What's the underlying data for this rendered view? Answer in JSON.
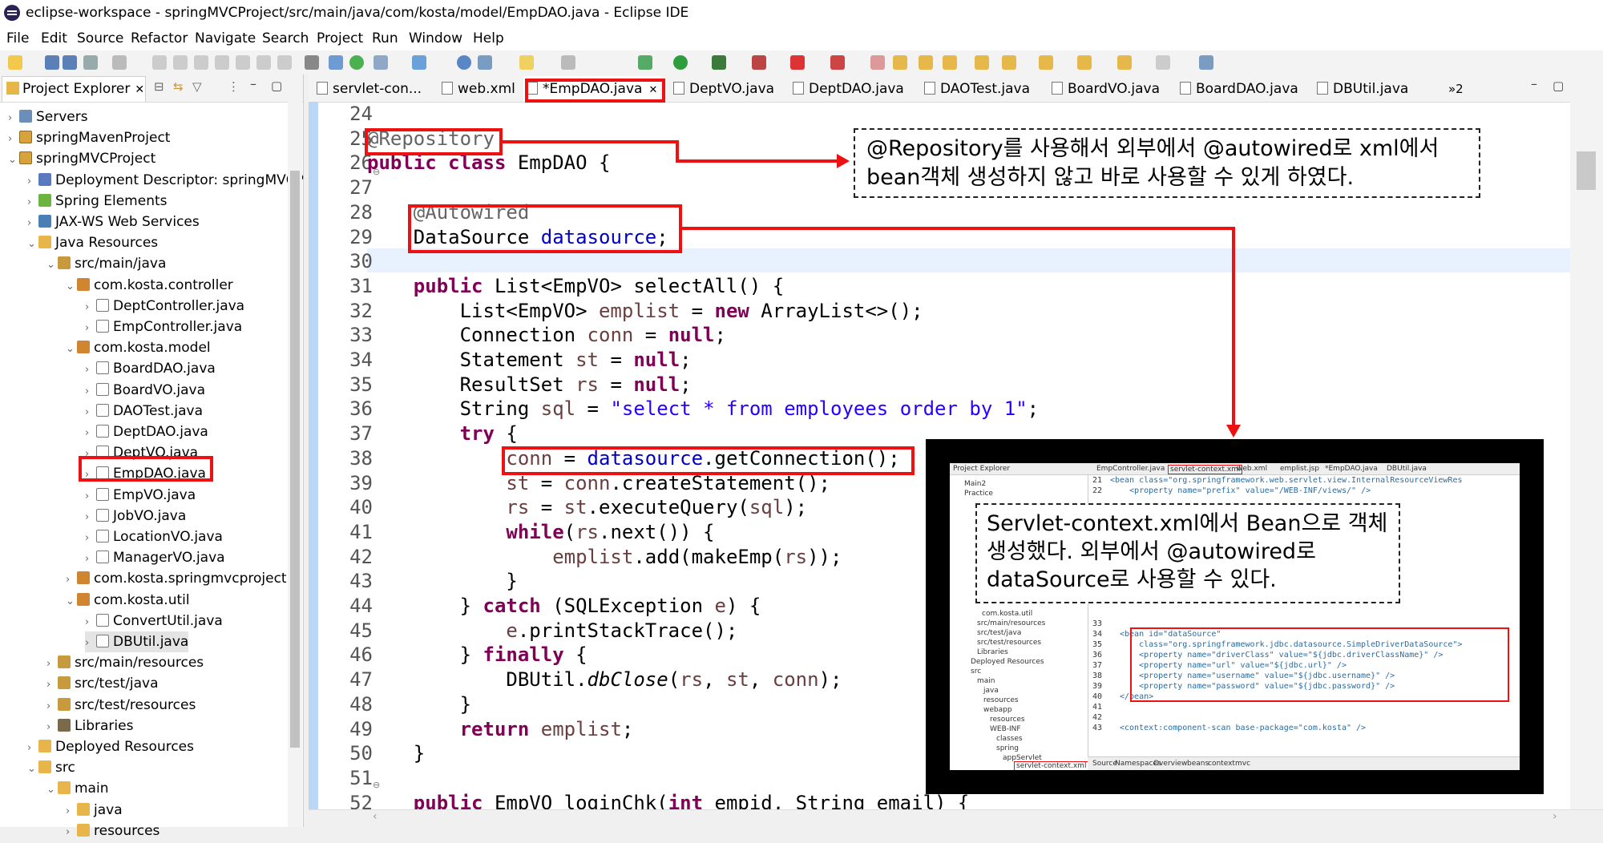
{
  "title": "eclipse-workspace - springMVCProject/src/main/java/com/kosta/model/EmpDAO.java - Eclipse IDE",
  "menu": [
    "File",
    "Edit",
    "Source",
    "Refactor",
    "Navigate",
    "Search",
    "Project",
    "Run",
    "Window",
    "Help"
  ],
  "sidebar": {
    "tab_label": "Project Explorer",
    "items": [
      {
        "label": "Servers",
        "arrow": "›",
        "icon": "servers"
      },
      {
        "label": "springMavenProject",
        "arrow": "›",
        "icon": "project"
      },
      {
        "label": "springMVCProject",
        "arrow": "⌄",
        "icon": "project"
      },
      {
        "label": "Deployment Descriptor: springMVCP",
        "arrow": "›",
        "icon": "dd"
      },
      {
        "label": "Spring Elements",
        "arrow": "›",
        "icon": "spring"
      },
      {
        "label": "JAX-WS Web Services",
        "arrow": "›",
        "icon": "jaxws"
      },
      {
        "label": "Java Resources",
        "arrow": "⌄",
        "icon": "folder"
      },
      {
        "label": "src/main/java",
        "arrow": "⌄",
        "icon": "src"
      },
      {
        "label": "com.kosta.controller",
        "arrow": "⌄",
        "icon": "pkg"
      },
      {
        "label": "DeptController.java",
        "arrow": "›",
        "icon": "java"
      },
      {
        "label": "EmpController.java",
        "arrow": "›",
        "icon": "java"
      },
      {
        "label": "com.kosta.model",
        "arrow": "⌄",
        "icon": "pkg"
      },
      {
        "label": "BoardDAO.java",
        "arrow": "›",
        "icon": "java"
      },
      {
        "label": "BoardVO.java",
        "arrow": "›",
        "icon": "java"
      },
      {
        "label": "DAOTest.java",
        "arrow": "›",
        "icon": "java"
      },
      {
        "label": "DeptDAO.java",
        "arrow": "›",
        "icon": "java"
      },
      {
        "label": "DeptVO.java",
        "arrow": "›",
        "icon": "java"
      },
      {
        "label": "EmpDAO.java",
        "arrow": "›",
        "icon": "java"
      },
      {
        "label": "EmpVO.java",
        "arrow": "›",
        "icon": "java"
      },
      {
        "label": "JobVO.java",
        "arrow": "›",
        "icon": "java"
      },
      {
        "label": "LocationVO.java",
        "arrow": "›",
        "icon": "java"
      },
      {
        "label": "ManagerVO.java",
        "arrow": "›",
        "icon": "java"
      },
      {
        "label": "com.kosta.springmvcproject",
        "arrow": "›",
        "icon": "pkg"
      },
      {
        "label": "com.kosta.util",
        "arrow": "⌄",
        "icon": "pkg"
      },
      {
        "label": "ConvertUtil.java",
        "arrow": "›",
        "icon": "java"
      },
      {
        "label": "DBUtil.java",
        "arrow": "›",
        "icon": "java"
      },
      {
        "label": "src/main/resources",
        "arrow": "›",
        "icon": "src"
      },
      {
        "label": "src/test/java",
        "arrow": "›",
        "icon": "src"
      },
      {
        "label": "src/test/resources",
        "arrow": "›",
        "icon": "src"
      },
      {
        "label": "Libraries",
        "arrow": "›",
        "icon": "lib"
      },
      {
        "label": "Deployed Resources",
        "arrow": "›",
        "icon": "folder"
      },
      {
        "label": "src",
        "arrow": "⌄",
        "icon": "folder"
      },
      {
        "label": "main",
        "arrow": "⌄",
        "icon": "folder"
      },
      {
        "label": "java",
        "arrow": "›",
        "icon": "folder"
      },
      {
        "label": "resources",
        "arrow": "›",
        "icon": "folder"
      }
    ]
  },
  "editor": {
    "tabs": [
      {
        "label": "servlet-con...",
        "active": false
      },
      {
        "label": "web.xml",
        "active": false
      },
      {
        "label": "*EmpDAO.java",
        "active": true
      },
      {
        "label": "DeptVO.java",
        "active": false
      },
      {
        "label": "DeptDAO.java",
        "active": false
      },
      {
        "label": "DAOTest.java",
        "active": false
      },
      {
        "label": "BoardVO.java",
        "active": false
      },
      {
        "label": "BoardDAO.java",
        "active": false
      },
      {
        "label": "DBUtil.java",
        "active": false
      }
    ],
    "overflow_label": "»2",
    "line_numbers": [
      "24",
      "25",
      "26",
      "27",
      "28",
      "29",
      "30",
      "31",
      "32",
      "33",
      "34",
      "35",
      "36",
      "37",
      "38",
      "39",
      "40",
      "41",
      "42",
      "43",
      "44",
      "45",
      "46",
      "47",
      "48",
      "49",
      "50",
      "51",
      "52"
    ]
  },
  "code": {
    "l25": "@Repository",
    "l26a": "public class",
    "l26b": " EmpDAO {",
    "l28": "@Autowired",
    "l29a": "DataSource ",
    "l29b": "datasource",
    "l29c": ";",
    "l31a": "public",
    "l31b": " List<EmpVO> selectAll() {",
    "l32a": "List<EmpVO> ",
    "l32b": "emplist",
    "l32c": " = ",
    "l32d": "new",
    "l32e": " ArrayList<>();",
    "l33a": "Connection ",
    "l33b": "conn",
    "l33c": " = ",
    "l33d": "null",
    "l33e": ";",
    "l34a": "Statement ",
    "l34b": "st",
    "l34c": " = ",
    "l34d": "null",
    "l34e": ";",
    "l35a": "ResultSet ",
    "l35b": "rs",
    "l35c": " = ",
    "l35d": "null",
    "l35e": ";",
    "l36a": "String ",
    "l36b": "sql",
    "l36c": " = ",
    "l36d": "\"select * from employees order by 1\"",
    "l36e": ";",
    "l37a": "try",
    "l37b": " {",
    "l38a": "conn",
    "l38b": " = ",
    "l38c": "datasource",
    "l38d": ".getConnection();",
    "l39a": "st",
    "l39b": " = ",
    "l39c": "conn",
    "l39d": ".createStatement();",
    "l40a": "rs",
    "l40b": " = ",
    "l40c": "st",
    "l40d": ".executeQuery(",
    "l40e": "sql",
    "l40f": ");",
    "l41a": "while",
    "l41b": "(",
    "l41c": "rs",
    "l41d": ".next()) {",
    "l42a": "emplist",
    "l42b": ".add(makeEmp(",
    "l42c": "rs",
    "l42d": "));",
    "l43": "}",
    "l44a": "} ",
    "l44b": "catch",
    "l44c": " (SQLException ",
    "l44d": "e",
    "l44e": ") {",
    "l45a": "e",
    "l45b": ".printStackTrace();",
    "l46a": "} ",
    "l46b": "finally",
    "l46c": " {",
    "l47a": "DBUtil.",
    "l47b": "dbClose",
    "l47c": "(",
    "l47d": "rs",
    "l47e": ", ",
    "l47f": "st",
    "l47g": ", ",
    "l47h": "conn",
    "l47i": ");",
    "l48": "}",
    "l49a": "return",
    "l49b": " ",
    "l49c": "emplist",
    "l49d": ";",
    "l50": "}",
    "l52a": "public",
    "l52b": " EmpVO loginChk(",
    "l52c": "int",
    "l52d": " empid, String email) {"
  },
  "annotations": {
    "callout1": "@Repository를 사용해서 외부에서 @autowired로 xml에서 bean객체 생성하지 않고 바로 사용할 수 있게 하였다.",
    "callout2": "Servlet-context.xml에서 Bean으로 객체 생성했다. 외부에서 @autowired로 dataSource로 사용할 수 있다."
  },
  "inset": {
    "tabs": [
      "Project Explorer",
      "EmpController.java",
      "servlet-context.xml",
      "web.xml",
      "emplist.jsp",
      "*EmpDAO.java",
      "DBUtil.java"
    ],
    "tree": [
      "Main2",
      "Practice",
      "com.kosta.util",
      "src/main/resources",
      "src/test/java",
      "src/test/resources",
      "Libraries",
      "Deployed Resources",
      "src",
      "main",
      "java",
      "resources",
      "webapp",
      "resources",
      "WEB-INF",
      "classes",
      "spring",
      "appServlet",
      "servlet-context.xml"
    ],
    "lines": [
      {
        "n": "21",
        "t": "<bean class=\"org.springframework.web.servlet.view.InternalResourceViewRes"
      },
      {
        "n": "22",
        "t": "    <property name=\"prefix\" value=\"/WEB-INF/views/\" />"
      },
      {
        "n": "33",
        "t": ""
      },
      {
        "n": "34",
        "t": "<bean id=\"dataSource\""
      },
      {
        "n": "35",
        "t": "    class=\"org.springframework.jdbc.datasource.SimpleDriverDataSource\">"
      },
      {
        "n": "36",
        "t": "    <property name=\"driverClass\" value=\"${jdbc.driverClassName}\" />"
      },
      {
        "n": "37",
        "t": "    <property name=\"url\" value=\"${jdbc.url}\" />"
      },
      {
        "n": "38",
        "t": "    <property name=\"username\" value=\"${jdbc.username}\" />"
      },
      {
        "n": "39",
        "t": "    <property name=\"password\" value=\"${jdbc.password}\" />"
      },
      {
        "n": "40",
        "t": "</bean>"
      },
      {
        "n": "41",
        "t": ""
      },
      {
        "n": "42",
        "t": ""
      },
      {
        "n": "43",
        "t": "<context:component-scan base-package=\"com.kosta\" />"
      }
    ],
    "bottom_tabs": [
      "Source",
      "Namespaces",
      "Overview",
      "beans",
      "context",
      "mvc"
    ]
  }
}
